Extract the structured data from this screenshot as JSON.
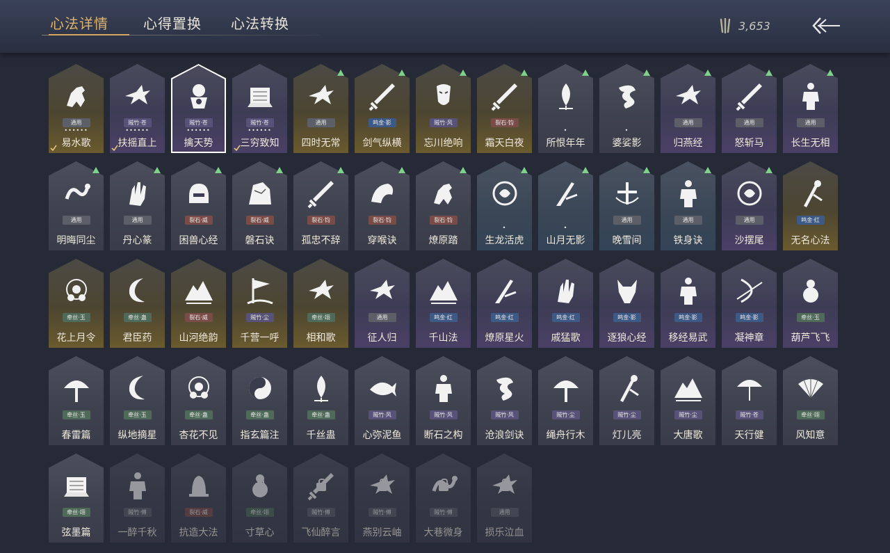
{
  "tabs": [
    "心法详情",
    "心得置换",
    "心法转换"
  ],
  "currency": {
    "value": "3,653",
    "icon": "bamboo-slips-icon"
  },
  "back_icon": "back-arrow-icon",
  "cards": [
    {
      "name": "易水歌",
      "tag": "通用",
      "tagc": "t-grey",
      "bg": "gold",
      "dots": "••••••",
      "check": true,
      "emblem": "horse"
    },
    {
      "name": "扶摇直上",
      "tag": "贼竹·苍",
      "tagc": "t-purple",
      "bg": "purple",
      "dots": "••••••",
      "check": true,
      "emblem": "bird"
    },
    {
      "name": "擒天势",
      "tag": "贼竹·苍",
      "tagc": "t-purple",
      "bg": "purple",
      "dots": "••••••",
      "selected": true,
      "emblem": "chain"
    },
    {
      "name": "三穷致知",
      "tag": "贼竹·苍",
      "tagc": "t-purple",
      "bg": "purple",
      "dots": "••••••",
      "check": true,
      "emblem": "scroll"
    },
    {
      "name": "四时无常",
      "tag": "通用",
      "tagc": "t-grey",
      "bg": "gold",
      "up": true,
      "emblem": "bird"
    },
    {
      "name": "剑气纵横",
      "tag": "鸣金·影",
      "tagc": "t-blue",
      "bg": "gold",
      "up": true,
      "emblem": "sword"
    },
    {
      "name": "忘川绝响",
      "tag": "贼竹·风",
      "tagc": "t-purple",
      "bg": "gold",
      "up": true,
      "emblem": "mask"
    },
    {
      "name": "霜天白夜",
      "tag": "裂石·钧",
      "tagc": "t-red",
      "bg": "gold",
      "up": true,
      "emblem": "sword"
    },
    {
      "name": "所恨年年",
      "tag": "",
      "tagc": "",
      "bg": "grey",
      "up": true,
      "dots": "•",
      "emblem": "leaf"
    },
    {
      "name": "婆娑影",
      "tag": "",
      "tagc": "",
      "bg": "grey",
      "up": true,
      "dots": "•",
      "emblem": "dragon"
    },
    {
      "name": "归燕经",
      "tag": "通用",
      "tagc": "t-grey",
      "bg": "purple",
      "up": true,
      "emblem": "bird"
    },
    {
      "name": "怒斩马",
      "tag": "通用",
      "tagc": "t-grey",
      "bg": "purple",
      "up": true,
      "emblem": "sword"
    },
    {
      "name": "长生无相",
      "tag": "通用",
      "tagc": "t-grey",
      "bg": "purple",
      "up": true,
      "emblem": "figure"
    },
    {
      "name": "明晦同尘",
      "tag": "通用",
      "tagc": "t-grey",
      "bg": "grey",
      "up": true,
      "emblem": "snake"
    },
    {
      "name": "丹心篆",
      "tag": "通用",
      "tagc": "t-grey",
      "bg": "grey",
      "up": true,
      "emblem": "hand"
    },
    {
      "name": "困兽心经",
      "tag": "裂石·威",
      "tagc": "t-red",
      "bg": "grey",
      "up": true,
      "emblem": "helmet"
    },
    {
      "name": "磐石诀",
      "tag": "裂石·威",
      "tagc": "t-red",
      "bg": "grey",
      "up": true,
      "emblem": "rock"
    },
    {
      "name": "孤忠不辞",
      "tag": "裂石·钧",
      "tagc": "t-red",
      "bg": "grey",
      "up": true,
      "emblem": "sword"
    },
    {
      "name": "穿喉诀",
      "tag": "裂石·钧",
      "tagc": "t-red",
      "bg": "grey",
      "up": true,
      "emblem": "claw"
    },
    {
      "name": "燎原踏",
      "tag": "裂石·钧",
      "tagc": "t-red",
      "bg": "grey",
      "up": true,
      "emblem": "horse"
    },
    {
      "name": "生龙活虎",
      "tag": "",
      "tagc": "",
      "bg": "teal",
      "up": true,
      "dots": "•",
      "emblem": "swirl"
    },
    {
      "name": "山月无影",
      "tag": "",
      "tagc": "",
      "bg": "teal",
      "up": true,
      "dots": "•",
      "emblem": "blade"
    },
    {
      "name": "晚雪间",
      "tag": "通用",
      "tagc": "t-grey",
      "bg": "teal",
      "up": true,
      "emblem": "cross"
    },
    {
      "name": "铁身诀",
      "tag": "通用",
      "tagc": "t-grey",
      "bg": "teal",
      "up": true,
      "emblem": "figure"
    },
    {
      "name": "沙摆尾",
      "tag": "通用",
      "tagc": "t-grey",
      "bg": "purple",
      "up": true,
      "emblem": "swirl"
    },
    {
      "name": "无名心法",
      "tag": "鸣金·红",
      "tagc": "t-blue",
      "bg": "gold",
      "emblem": "staff"
    },
    {
      "name": "花上月令",
      "tag": "牵丝·玉",
      "tagc": "t-green",
      "bg": "gold",
      "emblem": "flower"
    },
    {
      "name": "君臣药",
      "tag": "牵丝·蛊",
      "tagc": "t-green",
      "bg": "gold",
      "emblem": "moon"
    },
    {
      "name": "山河绝韵",
      "tag": "裂石·威",
      "tagc": "t-red",
      "bg": "gold",
      "emblem": "mountain"
    },
    {
      "name": "千营一呼",
      "tag": "贼竹·尘",
      "tagc": "t-purple",
      "bg": "gold",
      "emblem": "flag"
    },
    {
      "name": "相和歌",
      "tag": "牵丝·翊",
      "tagc": "t-green",
      "bg": "gold",
      "emblem": "bird"
    },
    {
      "name": "征人归",
      "tag": "通用",
      "tagc": "t-grey",
      "bg": "purple",
      "emblem": "bird"
    },
    {
      "name": "千山法",
      "tag": "鸣金·红",
      "tagc": "t-blue",
      "bg": "purple",
      "emblem": "mountain"
    },
    {
      "name": "燎原星火",
      "tag": "鸣金·红",
      "tagc": "t-blue",
      "bg": "purple",
      "emblem": "blade"
    },
    {
      "name": "戚猛歌",
      "tag": "鸣金·红",
      "tagc": "t-blue",
      "bg": "purple",
      "emblem": "hand"
    },
    {
      "name": "逐狼心经",
      "tag": "鸣金·影",
      "tagc": "t-blue",
      "bg": "purple",
      "emblem": "wolf"
    },
    {
      "name": "移经易武",
      "tag": "鸣金·影",
      "tagc": "t-blue",
      "bg": "purple",
      "emblem": "figure"
    },
    {
      "name": "凝神章",
      "tag": "鸣金·影",
      "tagc": "t-blue",
      "bg": "purple",
      "emblem": "bow"
    },
    {
      "name": "葫芦飞飞",
      "tag": "牵丝·玉",
      "tagc": "t-green",
      "bg": "purple",
      "emblem": "gourd"
    },
    {
      "name": "春雷篇",
      "tag": "牵丝·玉",
      "tagc": "t-green",
      "bg": "grey",
      "emblem": "tree"
    },
    {
      "name": "纵地摘星",
      "tag": "牵丝·玉",
      "tagc": "t-green",
      "bg": "grey",
      "emblem": "moon"
    },
    {
      "name": "杏花不见",
      "tag": "牵丝·蛊",
      "tagc": "t-green",
      "bg": "grey",
      "emblem": "flower"
    },
    {
      "name": "指玄篇注",
      "tag": "牵丝·蛊",
      "tagc": "t-green",
      "bg": "grey",
      "emblem": "yinyang"
    },
    {
      "name": "千丝蛊",
      "tag": "牵丝·蛊",
      "tagc": "t-green",
      "bg": "grey",
      "emblem": "leaf"
    },
    {
      "name": "心弥泥鱼",
      "tag": "贼竹·风",
      "tagc": "t-purple",
      "bg": "grey",
      "emblem": "fish"
    },
    {
      "name": "断石之构",
      "tag": "贼竹·风",
      "tagc": "t-purple",
      "bg": "grey",
      "emblem": "figure"
    },
    {
      "name": "沧浪剑诀",
      "tag": "贼竹·风",
      "tagc": "t-purple",
      "bg": "grey",
      "emblem": "dragon"
    },
    {
      "name": "绳舟行木",
      "tag": "贼竹·尘",
      "tagc": "t-purple",
      "bg": "grey",
      "emblem": "tree"
    },
    {
      "name": "灯儿亮",
      "tag": "贼竹·尘",
      "tagc": "t-purple",
      "bg": "grey",
      "emblem": "staff"
    },
    {
      "name": "大唐歌",
      "tag": "贼竹·尘",
      "tagc": "t-purple",
      "bg": "grey",
      "emblem": "mountain"
    },
    {
      "name": "天行健",
      "tag": "贼竹·苍",
      "tagc": "t-purple",
      "bg": "grey",
      "emblem": "umbrella"
    },
    {
      "name": "风知意",
      "tag": "牵丝·翊",
      "tagc": "t-green",
      "bg": "grey",
      "emblem": "fan"
    },
    {
      "name": "弦墨篇",
      "tag": "牵丝·翊",
      "tagc": "t-green",
      "bg": "grey",
      "emblem": "scroll"
    },
    {
      "name": "一醉千秋",
      "tag": "贼竹·傅",
      "tagc": "t-grey",
      "bg": "grey",
      "dim": true,
      "emblem": "figure"
    },
    {
      "name": "抗造大法",
      "tag": "裂石·威",
      "tagc": "t-red",
      "bg": "grey",
      "dim": true,
      "emblem": "bell"
    },
    {
      "name": "寸草心",
      "tag": "牵丝·翊",
      "tagc": "t-green",
      "bg": "grey",
      "dim": true,
      "lock": true,
      "emblem": "gourd"
    },
    {
      "name": "飞仙醉言",
      "tag": "贼竹·傅",
      "tagc": "t-grey",
      "bg": "grey",
      "dim": true,
      "lock": true,
      "emblem": "sword"
    },
    {
      "name": "燕别云岫",
      "tag": "贼竹·傅",
      "tagc": "t-grey",
      "bg": "grey",
      "dim": true,
      "lock": true,
      "emblem": "bird"
    },
    {
      "name": "大巷微身",
      "tag": "贼竹·傅",
      "tagc": "t-grey",
      "bg": "grey",
      "dim": true,
      "lock": true,
      "emblem": "snake"
    },
    {
      "name": "损乐泣血",
      "tag": "通用",
      "tagc": "t-grey",
      "bg": "grey",
      "dim": true,
      "lock": true,
      "emblem": "bird"
    }
  ]
}
